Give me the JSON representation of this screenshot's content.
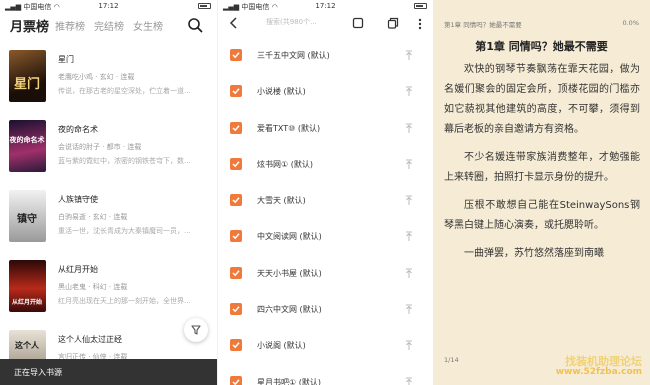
{
  "status_bar": {
    "carrier": "中国电信",
    "time": "17:12"
  },
  "rank_panel": {
    "tabs": [
      {
        "label": "月票榜",
        "active": true
      },
      {
        "label": "推荐榜",
        "active": false
      },
      {
        "label": "完结榜",
        "active": false
      },
      {
        "label": "女生榜",
        "active": false
      }
    ],
    "books": [
      {
        "title": "星门",
        "meta": "老鹰吃小鸡 · 玄幻 · 连载",
        "desc": "传说，在那古老的星空深处，伫立着一道...",
        "cover_color": "#2a1a10"
      },
      {
        "title": "夜的命名术",
        "meta": "会说话的肘子 · 都市 · 连载",
        "desc": "蓝与紫的霓虹中，浓密的钢铁苍穹下，数...",
        "cover_color": "#3a2446"
      },
      {
        "title": "人族镇守使",
        "meta": "白驹易逝 · 玄幻 · 连载",
        "desc": "重活一世，沈长青成为大秦镇魔司一员，...",
        "cover_color": "#d8d8d8"
      },
      {
        "title": "从红月开始",
        "meta": "黑山老鬼 · 科幻 · 连载",
        "desc": "红月亮出现在天上的那一刻开始，全世界...",
        "cover_color": "#5a1414"
      },
      {
        "title": "这个人仙太过正经",
        "meta": "言归正传 · 仙侠 · 连载",
        "desc": "",
        "cover_color": "#6b6258"
      }
    ],
    "toast": "正在导入书源"
  },
  "source_panel": {
    "search_placeholder": "搜索(共980个...",
    "sources": [
      {
        "name": "三千五中文网 (默认)"
      },
      {
        "name": "小说楼 (默认)"
      },
      {
        "name": "爱看TXT⑩ (默认)"
      },
      {
        "name": "炫书网① (默认)"
      },
      {
        "name": "大雪天 (默认)"
      },
      {
        "name": "中文阅读网 (默认)"
      },
      {
        "name": "天天小书屋 (默认)"
      },
      {
        "name": "四六中文网 (默认)"
      },
      {
        "name": "小说阁 (默认)"
      },
      {
        "name": "星月书吧① (默认)"
      }
    ],
    "accent_color": "#f07a3c"
  },
  "reader_panel": {
    "header_chapter": "第1章 同情吗？她最不需要",
    "progress": "0.0%",
    "chapter_title": "第1章 同情吗？她最不需要",
    "paragraphs": [
      "欢快的钢琴节奏飘荡在霏天花园，做为名媛们聚会的固定会所，顶楼花园的门槛亦如它藐视其他建筑的高度，不可攀，须得到幕后老板的亲自邀请方有资格。",
      "不少名媛连带家族消费整年，才勉强能上来转圈，拍照打卡显示身份的提升。",
      "压根不敢想自己能在SteinwaySons钢琴黑白键上随心演奏，或托腮聆听。",
      "一曲弹罢，苏竹悠然落座到南曦"
    ],
    "page_number": "1/14",
    "watermark_title": "找装机助理论坛",
    "watermark_url": "www.52fzba.com",
    "background_color": "#f6ecd6"
  }
}
